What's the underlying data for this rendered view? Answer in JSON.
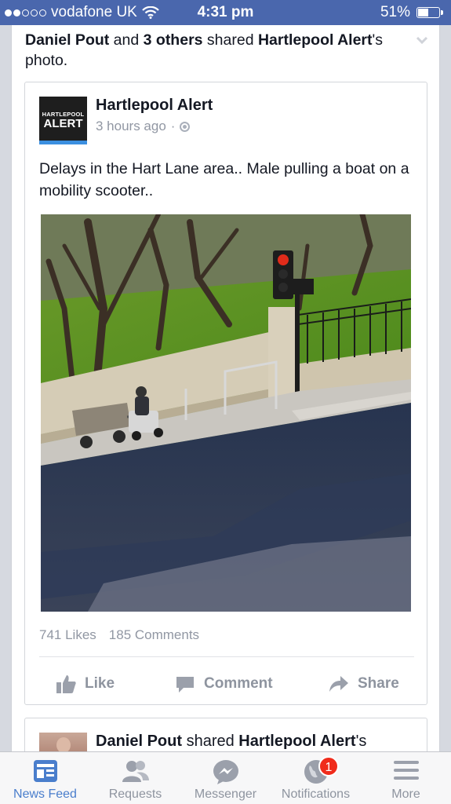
{
  "status_bar": {
    "carrier": "vodafone UK",
    "time": "4:31 pm",
    "battery": "51%",
    "battery_level": 0.51,
    "signal_bars_filled": 2,
    "signal_bars_total": 5
  },
  "story": {
    "actor": "Daniel Pout",
    "and_text": " and ",
    "others": "3 others",
    "shared_text": " shared ",
    "page": "Hartlepool Alert",
    "suffix": "'s photo."
  },
  "post": {
    "logo_line1": "HARTLEPOOL",
    "logo_line2": "ALERT",
    "page_name": "Hartlepool Alert",
    "time_ago": "3 hours ago",
    "meta_separator": "·",
    "privacy_icon": "globe-icon",
    "text": "Delays in the Hart Lane area.. Male pulling a boat on a mobility scooter..",
    "likes": "741 Likes",
    "comments": "185 Comments"
  },
  "actions": {
    "like": "Like",
    "comment": "Comment",
    "share": "Share"
  },
  "next_story": {
    "actor": "Daniel Pout",
    "shared_text": " shared ",
    "page": "Hartlepool Alert",
    "suffix": "'s"
  },
  "tabbar": {
    "items": [
      {
        "label": "News Feed",
        "icon": "news-feed-icon",
        "active": true
      },
      {
        "label": "Requests",
        "icon": "friend-requests-icon",
        "active": false
      },
      {
        "label": "Messenger",
        "icon": "messenger-icon",
        "active": false
      },
      {
        "label": "Notifications",
        "icon": "notifications-globe-icon",
        "active": false,
        "badge": "1"
      },
      {
        "label": "More",
        "icon": "menu-icon",
        "active": false
      }
    ]
  },
  "colors": {
    "brand_blue": "#4a67ad",
    "active_tab": "#4a7ecc",
    "badge_red": "#f02b1b",
    "muted_text": "#9197a3"
  }
}
